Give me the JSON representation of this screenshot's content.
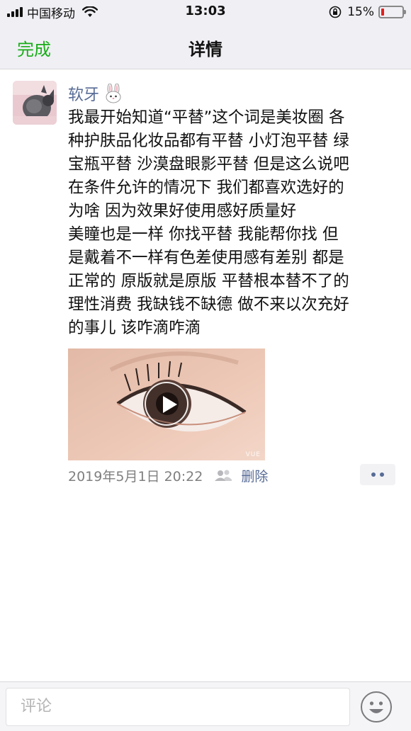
{
  "status_bar": {
    "carrier": "中国移动",
    "time": "13:03",
    "battery_percent": "15%",
    "battery_level": 0.15,
    "battery_color": "#e0201c"
  },
  "nav": {
    "done_label": "完成",
    "title": "详情"
  },
  "post": {
    "username": "软牙",
    "text_lines": [
      "我最开始知道“平替”这个词是美妆圈 各",
      "种护肤品化妆品都有平替 小灯泡平替 绿",
      "宝瓶平替 沙漠盘眼影平替 但是这么说吧",
      " 在条件允许的情况下 我们都喜欢选好的",
      " 为啥 因为效果好使用感好质量好",
      "美瞳也是一样 你找平替 我能帮你找 但",
      "是戴着不一样有色差使用感有差别 都是",
      "正常的 原版就是原版 平替根本替不了的",
      "理性消费 我缺钱不缺德 做不来以次充好",
      "的事儿 该咋滴咋滴"
    ],
    "video_watermark": "VUE",
    "timestamp": "2019年5月1日 20:22",
    "delete_label": "删除"
  },
  "comment_bar": {
    "placeholder": "评论"
  },
  "icons": {
    "signal": "signal-icon",
    "wifi": "wifi-icon",
    "lock": "orientation-lock-icon",
    "battery": "battery-icon",
    "bunny": "bunny-emoji-icon",
    "friends": "friends-visibility-icon",
    "more": "more-dots-icon",
    "emoji": "emoji-face-icon",
    "play": "play-icon"
  },
  "colors": {
    "accent_green": "#1aad19",
    "link_blue": "#576b95"
  }
}
